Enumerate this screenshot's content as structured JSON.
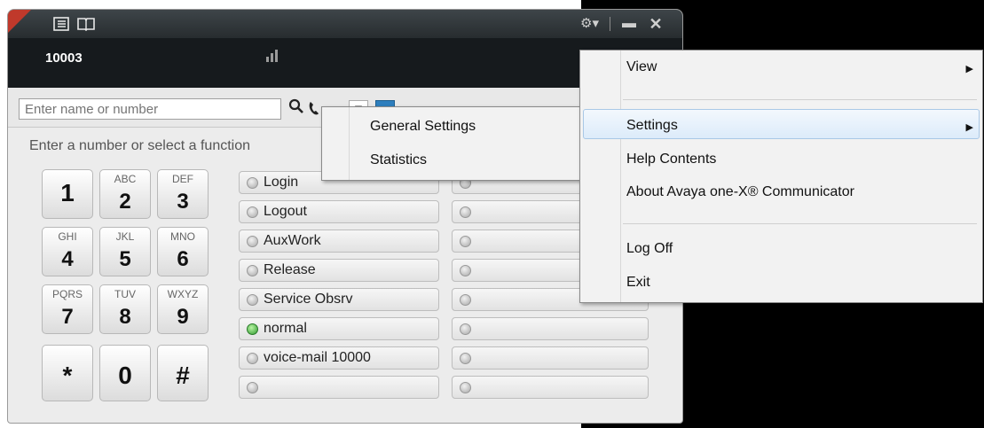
{
  "app": {
    "extension": "10003",
    "search": {
      "placeholder": "Enter name or number",
      "value": ""
    },
    "prompt": "Enter a number or select a function",
    "keypad": [
      {
        "letters": "",
        "digit": "1"
      },
      {
        "letters": "ABC",
        "digit": "2"
      },
      {
        "letters": "DEF",
        "digit": "3"
      },
      {
        "letters": "GHI",
        "digit": "4"
      },
      {
        "letters": "JKL",
        "digit": "5"
      },
      {
        "letters": "MNO",
        "digit": "6"
      },
      {
        "letters": "PQRS",
        "digit": "7"
      },
      {
        "letters": "TUV",
        "digit": "8"
      },
      {
        "letters": "WXYZ",
        "digit": "9"
      },
      {
        "letters": "",
        "digit": "*"
      },
      {
        "letters": "",
        "digit": "0"
      },
      {
        "letters": "",
        "digit": "#"
      }
    ],
    "function_buttons": [
      {
        "label": "Login",
        "led": "off"
      },
      {
        "label": "Logout",
        "led": "off"
      },
      {
        "label": "AuxWork",
        "led": "off"
      },
      {
        "label": "Release",
        "led": "off"
      },
      {
        "label": "Service Obsrv",
        "led": "off"
      },
      {
        "label": "normal",
        "led": "green"
      },
      {
        "label": "voice-mail 10000",
        "led": "off"
      },
      {
        "label": "",
        "led": "off"
      }
    ],
    "icons": {
      "contacts": "contacts-icon",
      "book": "book-icon",
      "gear": "gear-icon",
      "minimize": "minimize-icon",
      "close": "close-icon",
      "search": "search-icon"
    },
    "colors": {
      "led_green": "#2f9a2f",
      "menu_highlight": "#dcebfa",
      "title_red": "#c0392b"
    }
  },
  "settings_submenu": {
    "items": [
      "General Settings",
      "Statistics"
    ]
  },
  "main_menu": {
    "items": [
      {
        "label": "View",
        "has_submenu": true
      },
      {
        "label": "Settings",
        "has_submenu": true,
        "highlighted": true
      },
      {
        "label": "Help Contents",
        "has_submenu": false
      },
      {
        "label": "About Avaya one-X® Communicator",
        "has_submenu": false
      },
      {
        "label": "Log Off",
        "has_submenu": false
      },
      {
        "label": "Exit",
        "has_submenu": false
      }
    ]
  }
}
